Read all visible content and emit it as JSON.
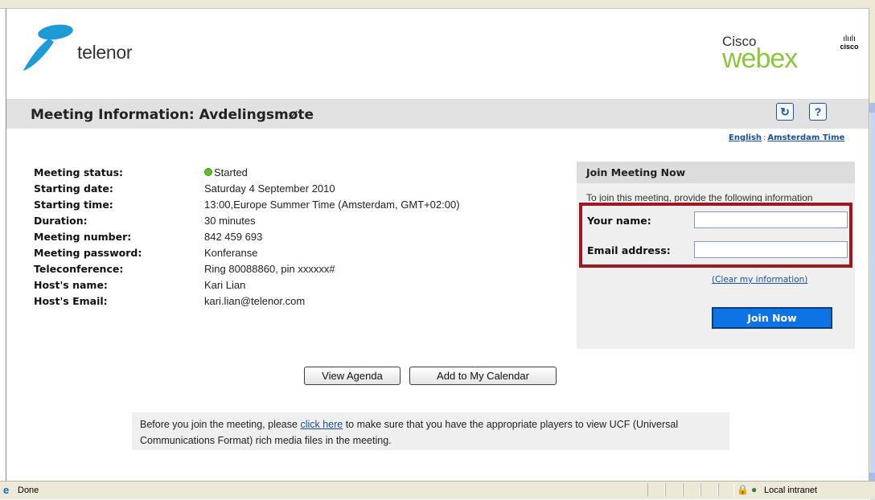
{
  "brand": {
    "telenor_word": "telenor",
    "cisco_word": "Cisco",
    "webex_word": "webex",
    "cisco_logo_text": "cisco",
    "cisco_logo_bars": "ılıılı"
  },
  "header": {
    "title": "Meeting Information: Avdelingsmøte",
    "refresh_glyph": "↻",
    "help_glyph": "?"
  },
  "locale": {
    "language": "English",
    "separator": ":",
    "timezone": "Amsterdam Time"
  },
  "meeting": {
    "rows": [
      {
        "label": "Meeting status:",
        "value": "Started"
      },
      {
        "label": "Starting date:",
        "value": "Saturday 4 September 2010"
      },
      {
        "label": "Starting time:",
        "value": "13:00,Europe Summer Time (Amsterdam, GMT+02:00)"
      },
      {
        "label": "Duration:",
        "value": "30 minutes"
      },
      {
        "label": "Meeting number:",
        "value": "842 459 693"
      },
      {
        "label": "Meeting password:",
        "value": "Konferanse"
      },
      {
        "label": "Teleconference:",
        "value": "Ring 80088860, pin xxxxxx#"
      },
      {
        "label": "Host's name:",
        "value": "Kari Lian"
      },
      {
        "label": "Host's Email:",
        "value": "kari.lian@telenor.com"
      }
    ],
    "status_color": "#5fbf2a"
  },
  "join": {
    "heading": "Join Meeting Now",
    "instruction": "To join this meeting, provide the following information",
    "name_label": "Your name:",
    "name_value": "",
    "email_label": "Email address:",
    "email_value": "",
    "clear_link": "(Clear my information)",
    "join_button": "Join Now",
    "highlight_color": "#9a1a1f"
  },
  "actions": {
    "view_agenda": "View Agenda",
    "add_calendar": "Add to My Calendar"
  },
  "players": {
    "before": "Before you join the meeting, please ",
    "link": "click here",
    "after": " to make sure that you have the appropriate players to view UCF (Universal Communications Format) rich media files in the meeting."
  },
  "statusbar": {
    "left_text": "Done",
    "zone_text": "Local intranet"
  }
}
